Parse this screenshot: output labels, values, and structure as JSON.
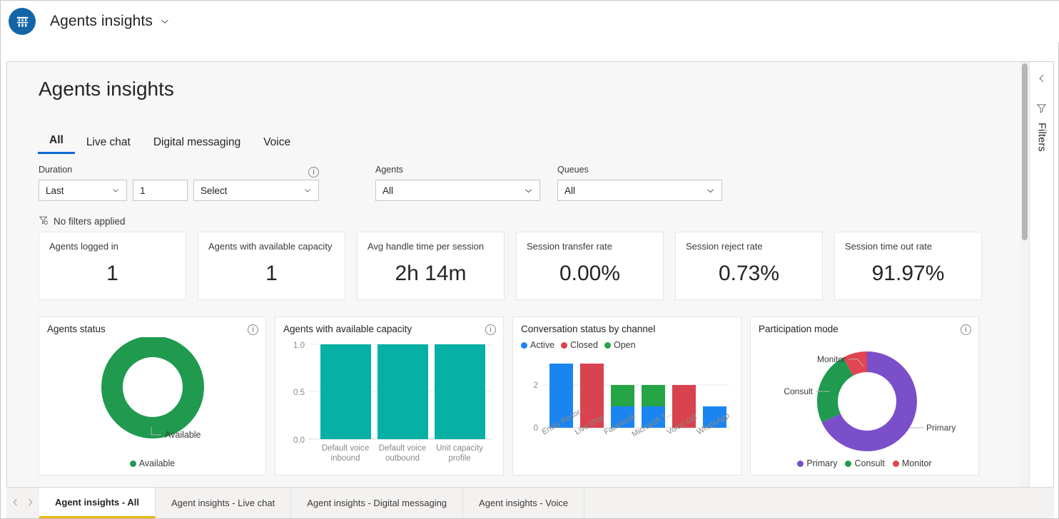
{
  "app": {
    "title": "Agents insights",
    "logo_icon": "dashboard-building-icon",
    "title_chevron_icon": "chevron-down-icon"
  },
  "report": {
    "title": "Agents insights",
    "tabs": [
      {
        "label": "All",
        "active": true
      },
      {
        "label": "Live chat",
        "active": false
      },
      {
        "label": "Digital messaging",
        "active": false
      },
      {
        "label": "Voice",
        "active": false
      }
    ],
    "filters": {
      "duration": {
        "label": "Duration",
        "info_icon": "info-icon",
        "relation_value": "Last",
        "amount_value": "1",
        "unit_value": "Select",
        "chevron_icon": "chevron-down-icon"
      },
      "agents": {
        "label": "Agents",
        "value": "All",
        "chevron_icon": "chevron-down-icon"
      },
      "queues": {
        "label": "Queues",
        "value": "All",
        "chevron_icon": "chevron-down-icon"
      },
      "status_text": "No filters applied",
      "status_icon": "filter-off-icon"
    },
    "kpis": [
      {
        "title": "Agents logged in",
        "value": "1"
      },
      {
        "title": "Agents with available capacity",
        "value": "1"
      },
      {
        "title": "Avg handle time per session",
        "value": "2h 14m"
      },
      {
        "title": "Session transfer rate",
        "value": "0.00%"
      },
      {
        "title": "Session reject rate",
        "value": "0.73%"
      },
      {
        "title": "Session time out rate",
        "value": "91.97%"
      }
    ]
  },
  "chart_data": [
    {
      "id": "agents-status",
      "type": "pie",
      "title": "Agents status",
      "info_icon": "info-icon",
      "labels": [
        "Available"
      ],
      "values": [
        1
      ],
      "percentages": [
        100
      ],
      "colors": [
        "#1f9a4f"
      ],
      "legend": [
        "Available"
      ],
      "legend_position": "bottom",
      "callout_label": "Available",
      "donut": true
    },
    {
      "id": "agents-with-available-capacity",
      "type": "bar",
      "title": "Agents with available capacity",
      "info_icon": "info-icon",
      "categories": [
        "Default voice inbound",
        "Default voice outbound",
        "Unit capacity profile"
      ],
      "values": [
        1.0,
        1.0,
        1.0
      ],
      "ytick_labels": [
        "0.0",
        "0.5",
        "1.0"
      ],
      "ylim": [
        0.0,
        1.0
      ],
      "xlabel": "",
      "ylabel": "",
      "color": "#07b0a4",
      "grid": true
    },
    {
      "id": "conversation-status-by-channel",
      "type": "bar",
      "title": "Conversation status by channel",
      "info_icon": null,
      "stacked": true,
      "categories": [
        "Entity Recor...",
        "Live chat",
        "Facebook",
        "Microsoft T...",
        "Voice call",
        "WhatsApp"
      ],
      "series": [
        {
          "name": "Active",
          "color": "#1a85f0",
          "values": [
            3,
            0,
            1,
            1,
            0,
            1
          ]
        },
        {
          "name": "Closed",
          "color": "#d8434f",
          "values": [
            0,
            3,
            0,
            0,
            2,
            0
          ]
        },
        {
          "name": "Open",
          "color": "#26a544",
          "values": [
            0,
            0,
            1,
            1,
            0,
            0
          ]
        }
      ],
      "ytick_labels": [
        "0",
        "2"
      ],
      "ylim": [
        0,
        3
      ],
      "legend": [
        "Active",
        "Closed",
        "Open"
      ],
      "legend_position": "top",
      "grid": true
    },
    {
      "id": "participation-mode",
      "type": "pie",
      "title": "Participation mode",
      "info_icon": "info-icon",
      "labels": [
        "Primary",
        "Consult",
        "Monitor"
      ],
      "percentages": [
        68,
        24,
        8
      ],
      "colors": [
        "#7b4fc9",
        "#1f9a4f",
        "#e04551"
      ],
      "legend": [
        "Primary",
        "Consult",
        "Monitor"
      ],
      "legend_position": "bottom",
      "callouts": [
        "Monitor",
        "Consult",
        "Primary"
      ],
      "donut": true
    }
  ],
  "right_rail": {
    "collapse_icon": "chevron-left-icon",
    "filter_icon": "filter-icon",
    "label": "Filters"
  },
  "bottom_bar": {
    "prev_icon": "chevron-left-icon",
    "next_icon": "chevron-right-icon",
    "page_tabs": [
      {
        "label": "Agent insights - All",
        "active": true
      },
      {
        "label": "Agent insights - Live chat",
        "active": false
      },
      {
        "label": "Agent insights - Digital messaging",
        "active": false
      },
      {
        "label": "Agent insights - Voice",
        "active": false
      }
    ]
  }
}
